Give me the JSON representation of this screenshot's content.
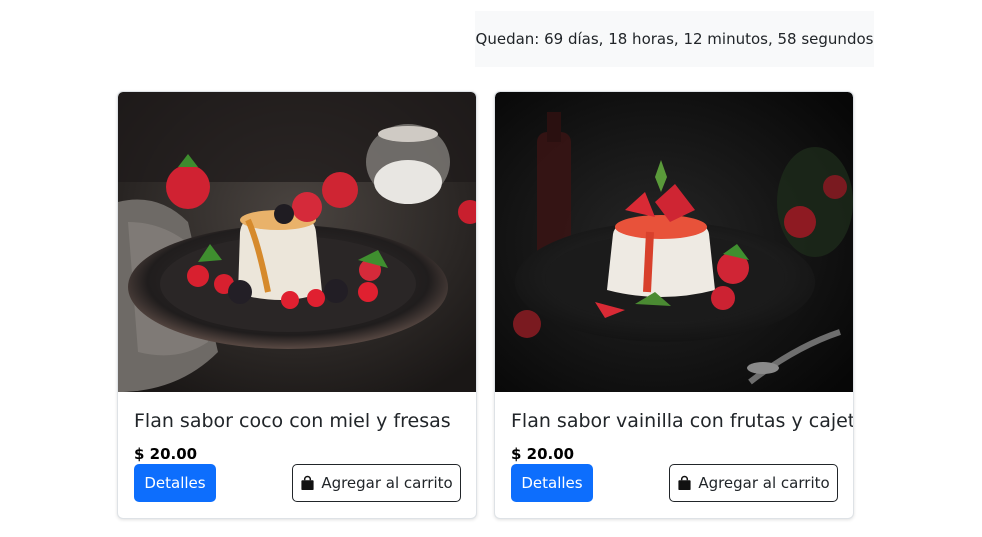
{
  "countdown": {
    "text": "Quedan: 69 días, 18 horas, 12 minutos, 58 segundos"
  },
  "products": [
    {
      "title": "Flan sabor coco con miel y fresas",
      "price": "$ 20.00",
      "details_label": "Detalles",
      "cart_label": "Agregar al carrito",
      "image_icon": "coconut-flan-photo"
    },
    {
      "title": "Flan sabor vainilla con frutas y cajeta",
      "price": "$ 20.00",
      "details_label": "Detalles",
      "cart_label": "Agregar al carrito",
      "image_icon": "vanilla-flan-photo"
    }
  ],
  "colors": {
    "primary": "#0d6efd",
    "dark": "#212529",
    "light_bg": "#f8f9fa"
  }
}
